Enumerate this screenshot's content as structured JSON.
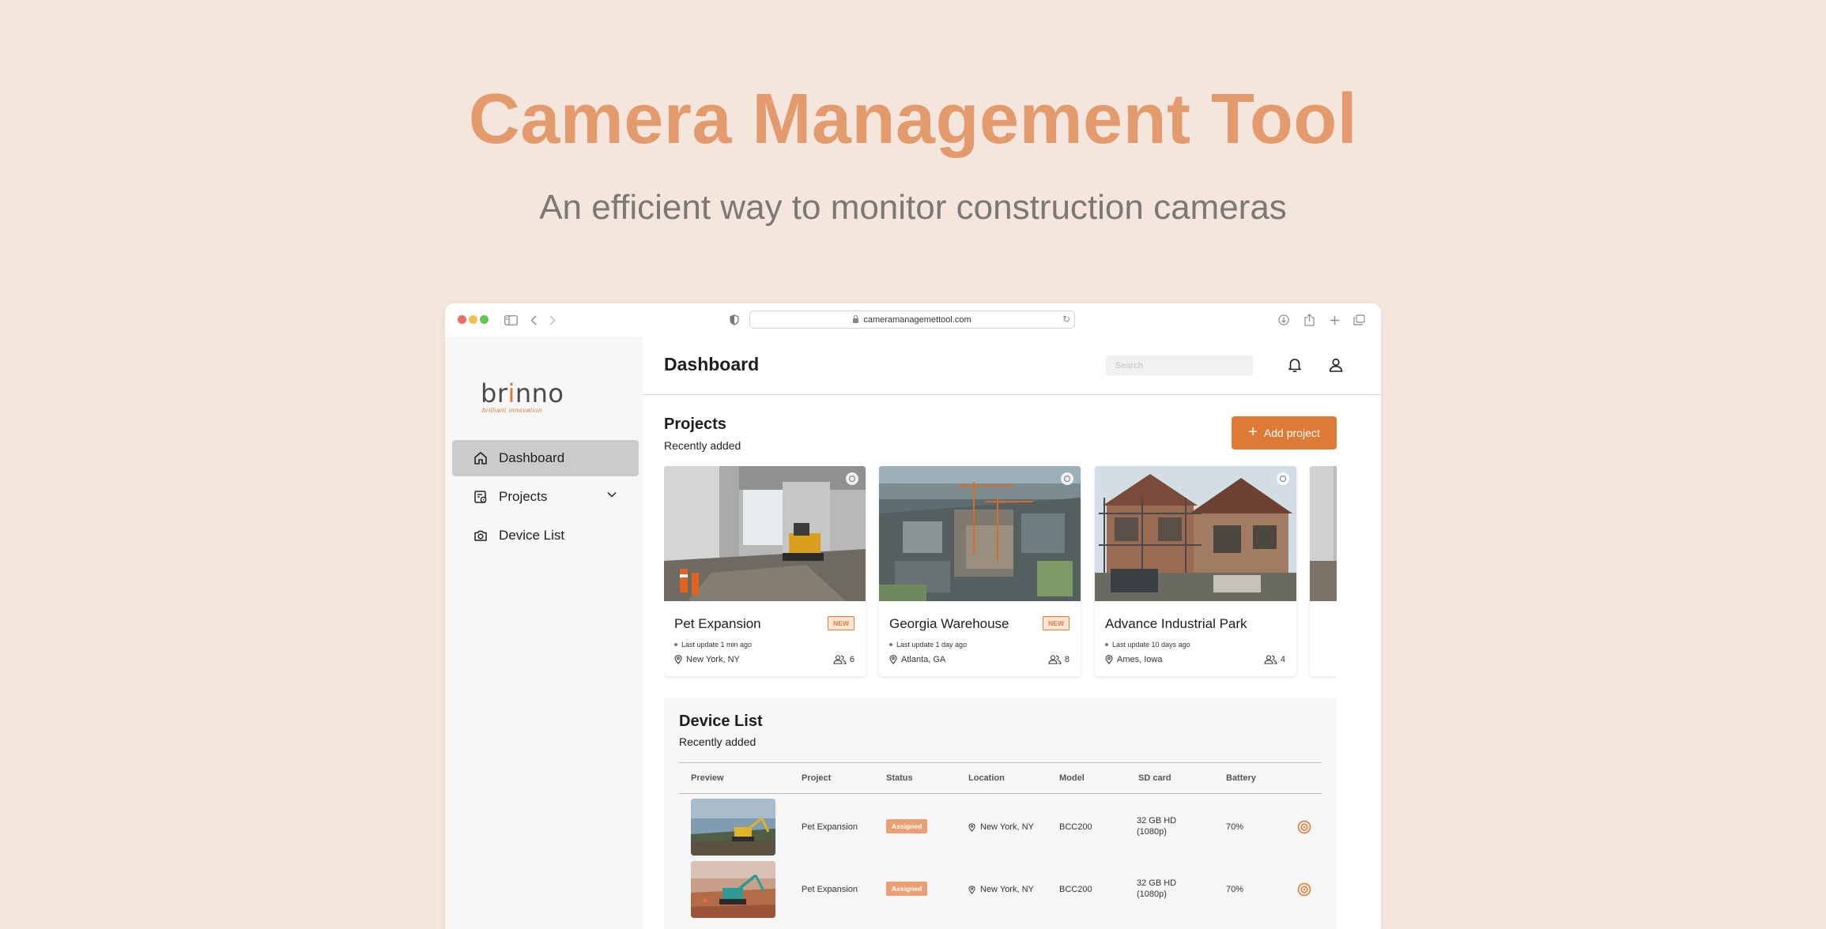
{
  "hero": {
    "title": "Camera Management Tool",
    "subtitle": "An efficient way to monitor construction cameras"
  },
  "browser": {
    "url": "cameramanagemettool.com"
  },
  "logo": {
    "word_left": "br",
    "word_accent": "i",
    "word_right": "nno",
    "tagline": "brilliant innovation"
  },
  "sidebar": {
    "items": [
      {
        "label": "Dashboard",
        "icon": "home-icon",
        "active": true
      },
      {
        "label": "Projects",
        "icon": "projects-icon",
        "active": false
      },
      {
        "label": "Device List",
        "icon": "camera-icon",
        "active": false
      }
    ]
  },
  "header": {
    "title": "Dashboard",
    "search_placeholder": "Search"
  },
  "projects": {
    "title": "Projects",
    "subtitle": "Recently added",
    "add_label": "Add project",
    "cards": [
      {
        "name": "Pet Expansion",
        "badge": "NEW",
        "updated": "Last update 1 min ago",
        "location": "New York, NY",
        "members": "6"
      },
      {
        "name": "Georgia Warehouse",
        "badge": "NEW",
        "updated": "Last update 1 day ago",
        "location": "Atlanta, GA",
        "members": "8"
      },
      {
        "name": "Advance Industrial Park",
        "badge": "",
        "updated": "Last update 10 days ago",
        "location": "Ames, Iowa",
        "members": "4"
      }
    ]
  },
  "devices": {
    "title": "Device List",
    "subtitle": "Recently added",
    "columns": [
      "Preview",
      "Project",
      "Status",
      "Location",
      "Model",
      "SD card",
      "Battery"
    ],
    "rows": [
      {
        "project": "Pet Expansion",
        "status": "Assigned",
        "location": "New York, NY",
        "model": "BCC200",
        "sd_line1": "32 GB HD",
        "sd_line2": "(1080p)",
        "battery": "70%"
      },
      {
        "project": "Pet Expansion",
        "status": "Assigned",
        "location": "New York, NY",
        "model": "BCC200",
        "sd_line1": "32 GB HD",
        "sd_line2": "(1080p)",
        "battery": "70%"
      }
    ]
  },
  "colors": {
    "accent": "#de7a36",
    "hero_title": "#e39a6c",
    "background": "#f4e6dd",
    "status_badge": "#ec9e74"
  }
}
